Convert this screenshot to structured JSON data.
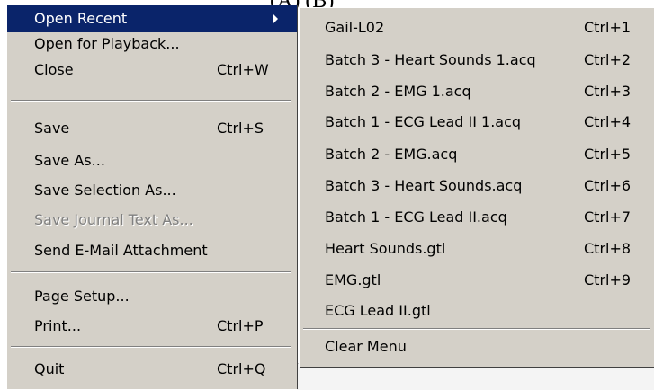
{
  "background": {
    "partial_text": "(A)                    (B)"
  },
  "file_menu": {
    "items": [
      {
        "label": "Open Recent",
        "has_submenu": true,
        "highlighted": true
      },
      {
        "label": "Open for Playback..."
      },
      {
        "label": "Close",
        "shortcut": "Ctrl+W"
      },
      {
        "label": "Save",
        "shortcut": "Ctrl+S"
      },
      {
        "label": "Save As..."
      },
      {
        "label": "Save Selection As..."
      },
      {
        "label": "Save Journal Text As...",
        "disabled": true
      },
      {
        "label": "Send E-Mail Attachment"
      },
      {
        "label": "Page Setup..."
      },
      {
        "label": "Print...",
        "shortcut": "Ctrl+P"
      },
      {
        "label": "Quit",
        "shortcut": "Ctrl+Q"
      }
    ]
  },
  "recent_menu": {
    "items": [
      {
        "label": "Gail-L02",
        "shortcut": "Ctrl+1"
      },
      {
        "label": "Batch 3 - Heart Sounds 1.acq",
        "shortcut": "Ctrl+2"
      },
      {
        "label": "Batch 2 - EMG 1.acq",
        "shortcut": "Ctrl+3"
      },
      {
        "label": "Batch 1 - ECG Lead II 1.acq",
        "shortcut": "Ctrl+4"
      },
      {
        "label": "Batch 2 - EMG.acq",
        "shortcut": "Ctrl+5"
      },
      {
        "label": "Batch 3 - Heart Sounds.acq",
        "shortcut": "Ctrl+6"
      },
      {
        "label": "Batch 1 - ECG Lead II.acq",
        "shortcut": "Ctrl+7"
      },
      {
        "label": "Heart Sounds.gtl",
        "shortcut": "Ctrl+8"
      },
      {
        "label": "EMG.gtl",
        "shortcut": "Ctrl+9"
      },
      {
        "label": "ECG Lead II.gtl"
      },
      {
        "label": "Clear Menu"
      }
    ]
  },
  "colors": {
    "menu_background": "#d4d0c8",
    "highlight": "#0a246a",
    "disabled_text": "#808080"
  }
}
